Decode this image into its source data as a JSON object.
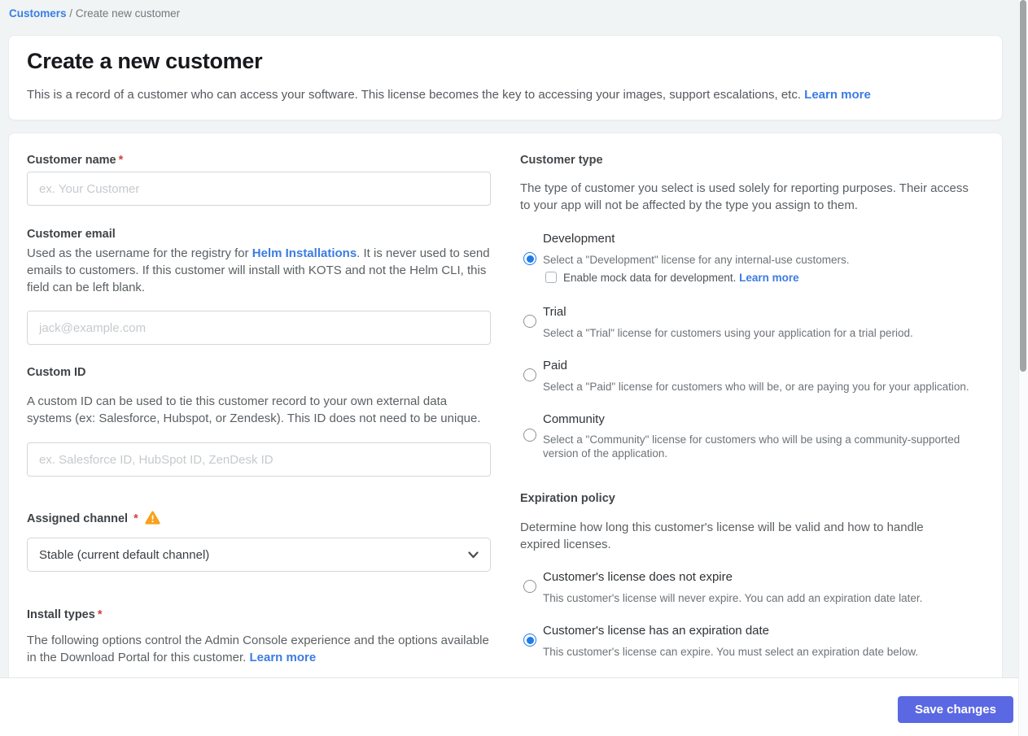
{
  "breadcrumb": {
    "link": "Customers",
    "separator": "/",
    "current": "Create new customer"
  },
  "header": {
    "title": "Create a new customer",
    "description": "This is a record of a customer who can access your software. This license becomes the key to accessing your images, support escalations, etc.",
    "learn_more": "Learn more"
  },
  "form": {
    "customer_name": {
      "label": "Customer name",
      "required": "*",
      "placeholder": "ex. Your Customer",
      "value": ""
    },
    "customer_email": {
      "label": "Customer email",
      "help_before": "Used as the username for the registry for ",
      "help_link": "Helm Installations",
      "help_after": ". It is never used to send emails to customers. If this customer will install with KOTS and not the Helm CLI, this field can be left blank.",
      "placeholder": "jack@example.com",
      "value": ""
    },
    "custom_id": {
      "label": "Custom ID",
      "help": "A custom ID can be used to tie this customer record to your own external data systems (ex: Salesforce, Hubspot, or Zendesk). This ID does not need to be unique.",
      "placeholder": "ex. Salesforce ID, HubSpot ID, ZenDesk ID",
      "value": ""
    },
    "assigned_channel": {
      "label": "Assigned channel",
      "required": "*",
      "warning_icon": "warning-triangle",
      "selected_option": "Stable (current default channel)"
    },
    "install_types": {
      "label": "Install types",
      "required": "*",
      "help": "The following options control the Admin Console experience and the options available in the Download Portal for this customer. ",
      "help_link": "Learn more"
    }
  },
  "customer_type": {
    "heading": "Customer type",
    "description": "The type of customer you select is used solely for reporting purposes. Their access to your app will not be affected by the type you assign to them.",
    "options": [
      {
        "label": "Development",
        "description": "Select a \"Development\" license for any internal-use customers.",
        "selected": true
      },
      {
        "label": "Trial",
        "description": "Select a \"Trial\" license for customers using your application for a trial period.",
        "selected": false
      },
      {
        "label": "Paid",
        "description": "Select a \"Paid\" license for customers who will be, or are paying you for your application.",
        "selected": false
      },
      {
        "label": "Community",
        "description": "Select a \"Community\" license for customers who will be using a community-supported version of the application.",
        "selected": false
      }
    ],
    "mock_checkbox": {
      "text": "Enable mock data for development. ",
      "link": "Learn more",
      "checked": false
    }
  },
  "expiration_policy": {
    "heading": "Expiration policy",
    "description": "Determine how long this customer's license will be valid and how to handle expired licenses.",
    "options": [
      {
        "label": "Customer's license does not expire",
        "description": "This customer's license will never expire. You can add an expiration date later.",
        "selected": false
      },
      {
        "label": "Customer's license has an expiration date",
        "description": "This customer's license can expire. You must select an expiration date below.",
        "selected": true
      }
    ]
  },
  "footer": {
    "save_label": "Save changes"
  },
  "colors": {
    "page_background": "#f0f4f5",
    "link_blue": "#3b7ce3",
    "save_button": "#5b68e3",
    "radio_selected_blue": "#1e7ce6",
    "required_asterisk_red": "#d0433c",
    "warning_amber": "#f7a21c"
  }
}
